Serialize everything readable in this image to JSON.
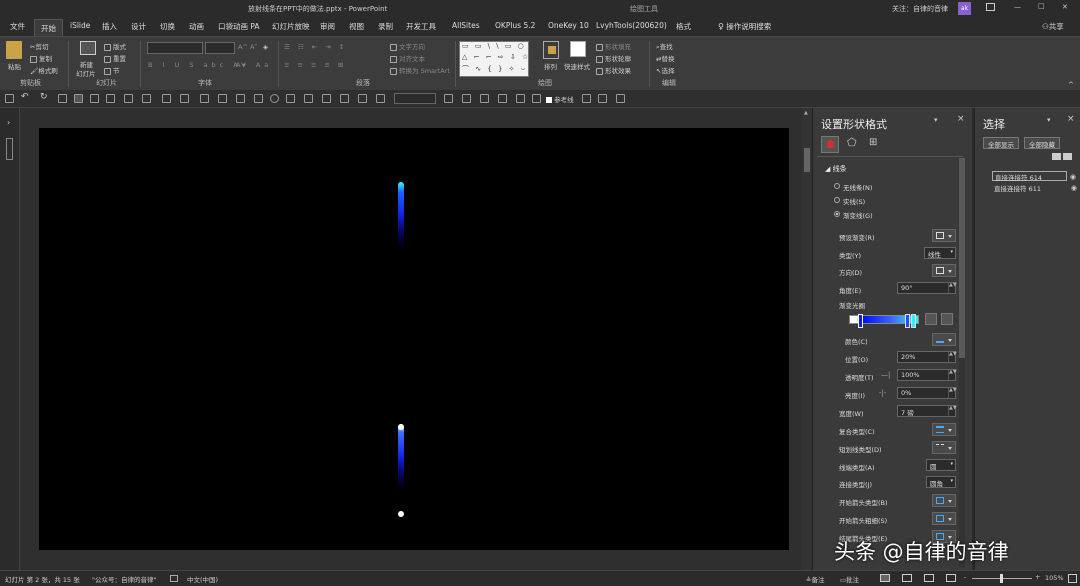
{
  "titlebar": {
    "file_name": "放射线条在PPT中的做法.pptx",
    "separator": " - ",
    "app": "PowerPoint",
    "context_tab": "绘图工具",
    "account": "关注：自律的音律",
    "avatar": "ak",
    "win_min": "—",
    "win_max": "□",
    "win_close": "✕"
  },
  "tabs": [
    "文件",
    "开始",
    "iSlide",
    "插入",
    "设计",
    "切换",
    "动画",
    "口袋动画 PA",
    "幻灯片放映",
    "审阅",
    "视图",
    "录制",
    "开发工具",
    "AllSites",
    "OKPlus 5.2",
    "OneKey 10",
    "LvyhTools(200620)",
    "格式"
  ],
  "tell_me": "操作说明搜索",
  "share": "共享",
  "ribbon": {
    "clipboard": {
      "paste": "粘贴",
      "cut": "剪切",
      "copy": "复制",
      "format_painter": "格式刷",
      "group": "剪贴板"
    },
    "slides": {
      "new_slide_1": "新建",
      "new_slide_2": "幻灯片",
      "layout": "版式",
      "reset": "重置",
      "section": "节",
      "group": "幻灯片"
    },
    "font": {
      "group": "字体"
    },
    "paragraph": {
      "text_direction": "文字方向",
      "align_text": "对齐文本",
      "convert_smartart": "转换为 SmartArt",
      "group": "段落"
    },
    "drawing": {
      "arrange": "排列",
      "quick_styles": "快速样式",
      "shape_fill": "形状填充",
      "shape_outline": "形状轮廓",
      "shape_effects": "形状效果",
      "group": "绘图"
    },
    "editing": {
      "find": "查找",
      "replace": "替换",
      "select": "选择",
      "group": "编辑"
    }
  },
  "qat": {
    "guides_label": "参考线"
  },
  "format_pane": {
    "title": "设置形状格式",
    "section": "线条",
    "radio_none": "无线条(N)",
    "radio_solid": "实线(S)",
    "radio_gradient": "渐变线(G)",
    "preset": "预设渐变(R)",
    "type_label": "类型(Y)",
    "type_value": "线性",
    "direction_label": "方向(D)",
    "angle_label": "角度(E)",
    "angle_value": "90°",
    "stops_label": "渐变光圈",
    "color_label": "颜色(C)",
    "position_label": "位置(O)",
    "position_value": "20%",
    "transparency_label": "透明度(T)",
    "transparency_value": "100%",
    "brightness_label": "亮度(I)",
    "brightness_value": "0%",
    "width_label": "宽度(W)",
    "width_value": "7 磅",
    "compound_label": "复合类型(C)",
    "dash_label": "短划线类型(D)",
    "cap_label": "线端类型(A)",
    "cap_value": "圆",
    "join_label": "连接类型(J)",
    "join_value": "圆角",
    "begin_arrow_type": "开始箭头类型(B)",
    "begin_arrow_size": "开始箭头粗细(S)",
    "end_arrow_type": "结尾箭头类型(E)"
  },
  "selection_pane": {
    "title": "选择",
    "show_all": "全部显示",
    "hide_all": "全部隐藏",
    "items": [
      "直接连接符 614",
      "直接连接符 611"
    ]
  },
  "status": {
    "slide_info": "幻灯片 第 2 张，共 15 张",
    "account_note": "\"公众号：自律的音律\"",
    "language": "中文(中国)",
    "notes": "备注",
    "comments": "批注",
    "zoom": "105%"
  },
  "watermark": "头条 @自律的音律",
  "colors": {
    "gradient_start": "#0050ff",
    "gradient_end": "#00e0ff",
    "slide_bg": "#000000"
  }
}
